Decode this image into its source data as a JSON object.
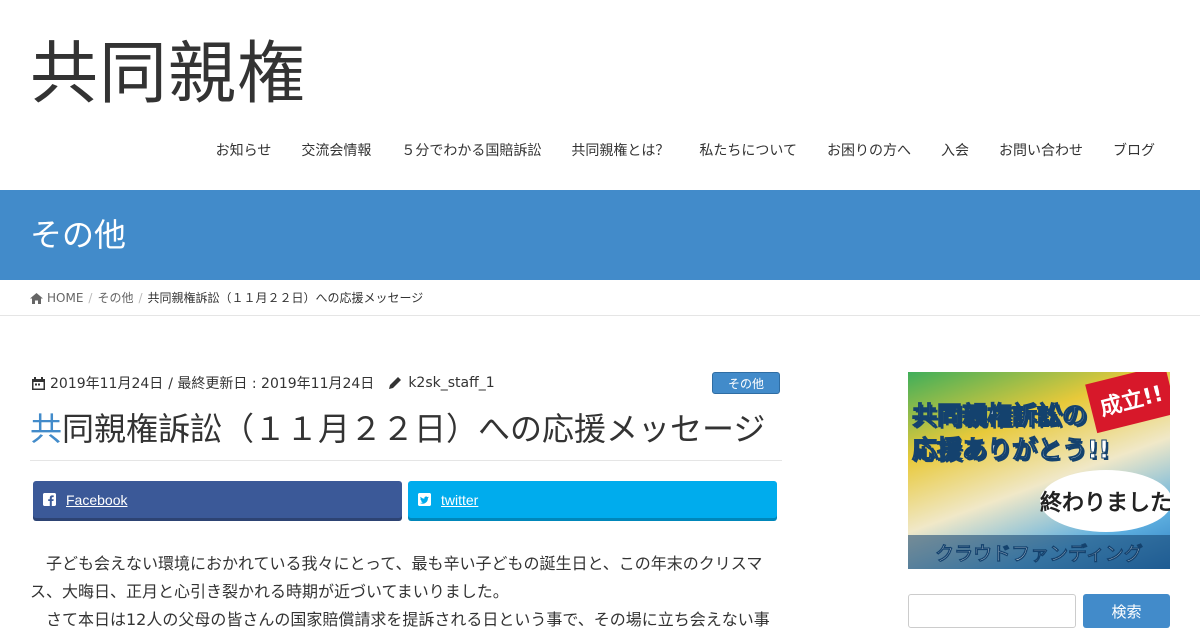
{
  "site": {
    "title": "共同親権"
  },
  "nav": {
    "items": [
      {
        "label": "お知らせ"
      },
      {
        "label": "交流会情報"
      },
      {
        "label": "５分でわかる国賠訴訟"
      },
      {
        "label": "共同親権とは？"
      },
      {
        "label": "私たちについて"
      },
      {
        "label": "お困りの方へ"
      },
      {
        "label": "入会"
      },
      {
        "label": "お問い合わせ"
      },
      {
        "label": "ブログ"
      }
    ]
  },
  "page_header": {
    "title": "その他"
  },
  "breadcrumb": {
    "home": "HOME",
    "separator": "/",
    "category": "その他",
    "current": "共同親権訴訟（１１月２２日）への応援メッセージ"
  },
  "post": {
    "meta": {
      "date": "2019年11月24日",
      "updated_text": "/ 最終更新日 : 2019年11月24日",
      "author": "k2sk_staff_1",
      "category": "その他"
    },
    "title_first": "共",
    "title_rest": "同親権訴訟（１１月２２日）への応援メッセージ",
    "share": {
      "facebook": "Facebook",
      "twitter": "twitter"
    },
    "paragraphs": [
      "子ども会えない環境におかれている我々にとって、最も辛い子どもの誕生日と、この年末のクリスマス、大晦日、正月と心引き裂かれる時期が近づいてまいりました。",
      "さて本日は12人の父母の皆さんの国家賠償請求を提訴される日という事で、その場に立ち会えない事"
    ]
  },
  "sidebar": {
    "banner": {
      "line1": "共同親権訴訟の",
      "line2": "応援ありがとう!!",
      "stamp": "成立!!",
      "bubble": "終わりました",
      "bottom": "クラウドファンディング"
    },
    "search": {
      "placeholder": "",
      "button": "検索"
    }
  },
  "colors": {
    "accent": "#428bca",
    "facebook": "#3b5998",
    "twitter": "#00aced",
    "stamp": "#d7182a"
  }
}
